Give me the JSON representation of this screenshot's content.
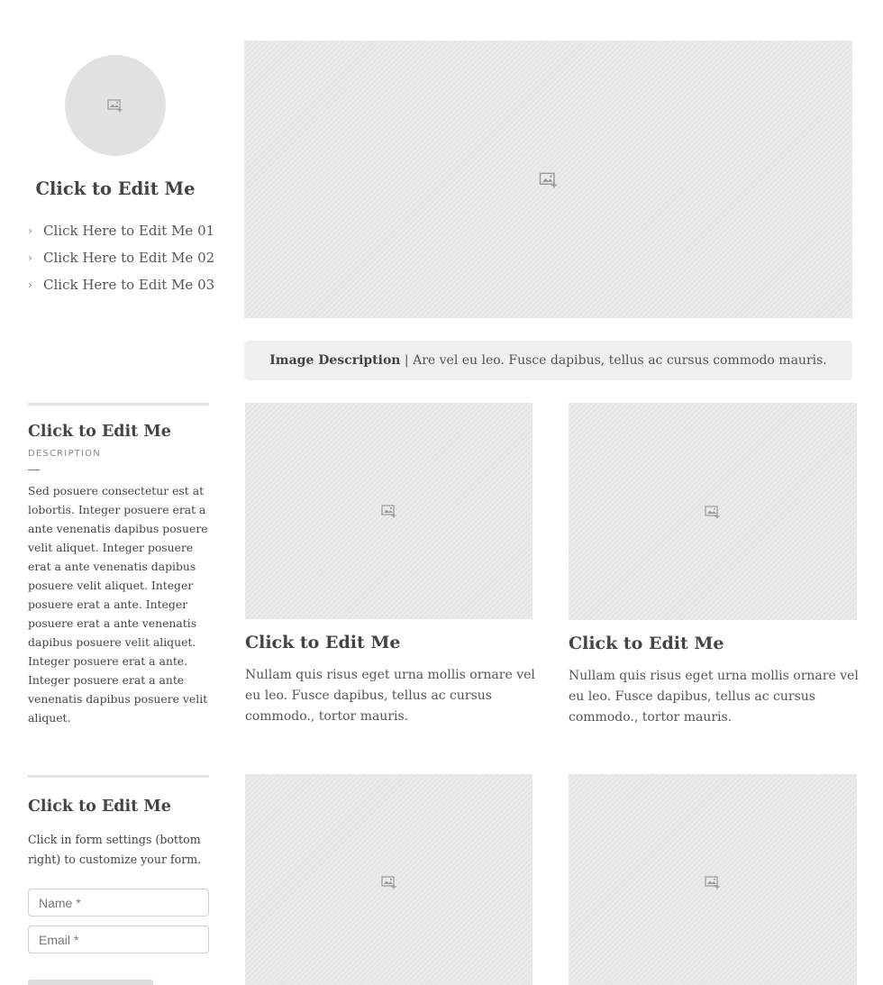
{
  "profile": {
    "title": "Click to Edit Me",
    "links": [
      {
        "bullet": "›",
        "label": "Click Here to Edit Me 01"
      },
      {
        "bullet": "›",
        "label": "Click Here to Edit Me 02"
      },
      {
        "bullet": "›",
        "label": "Click Here to Edit Me 03"
      }
    ]
  },
  "hero": {
    "caption_bold": "Image Description",
    "caption_separator": " | ",
    "caption_text": "Are vel eu leo. Fusce dapibus, tellus ac cursus commodo mauris."
  },
  "about": {
    "title": "Click to Edit Me",
    "subtitle": "DESCRIPTION",
    "body": "Sed posuere consectetur est at lobortis. Integer posuere erat a ante venenatis dapibus posuere velit aliquet. Integer posuere erat a ante venenatis dapibus posuere velit aliquet.  Integer posuere erat a ante. Integer posuere erat a ante venenatis dapibus posuere velit aliquet.  Integer posuere erat a ante.  Integer posuere erat a ante venenatis dapibus posuere velit aliquet."
  },
  "cards": [
    {
      "title": "Click to Edit Me",
      "body": "Nullam quis risus eget urna mollis ornare vel eu leo. Fusce dapibus, tellus ac cursus commodo., tortor mauris."
    },
    {
      "title": "Click to Edit Me",
      "body": "Nullam quis risus eget urna mollis ornare vel eu leo. Fusce dapibus, tellus ac cursus commodo., tortor mauris."
    }
  ],
  "contact": {
    "title": "Click to Edit Me",
    "note": "Click in form settings (bottom right) to customize your form.",
    "name_placeholder": "Name *",
    "email_placeholder": "Email *"
  },
  "icons": {
    "placeholder": "image-add-icon",
    "bullet": "chevron-right-icon"
  },
  "colors": {
    "placeholder_bg": "#e6e6e6",
    "caption_bg": "#efefef",
    "text": "#444444"
  }
}
